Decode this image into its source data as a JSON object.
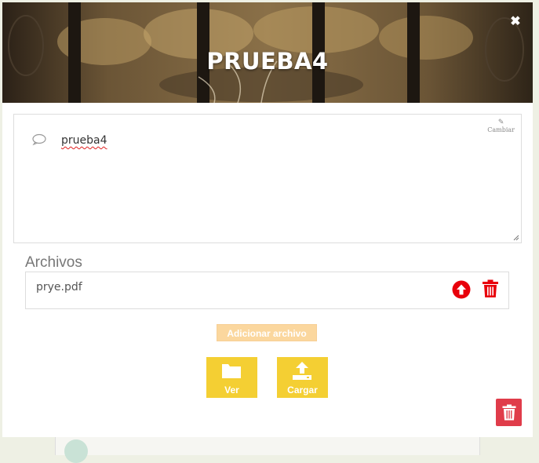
{
  "card": {
    "title": "PRUEBA4",
    "close_icon": "times-icon",
    "close_glyph": "✖"
  },
  "description": {
    "text": "prueba4",
    "icon": "comment-icon",
    "edit_label": "Cambiar",
    "edit_icon": "pencil-icon"
  },
  "files": {
    "title": "Archivos",
    "items": [
      {
        "name": "prye.pdf",
        "upload_icon": "arrow-circle-up-icon",
        "delete_icon": "trash-icon"
      }
    ]
  },
  "actions": {
    "add_file_label": "Adicionar archivo",
    "view_label": "Ver",
    "view_icon": "folder-icon",
    "upload_label": "Cargar",
    "upload_icon": "upload-icon",
    "delete_icon": "trash-icon"
  },
  "colors": {
    "accent_yellow": "#f4cf33",
    "add_button": "#fbd79e",
    "danger_red": "#e03c4a",
    "icon_red": "#e8000b"
  }
}
